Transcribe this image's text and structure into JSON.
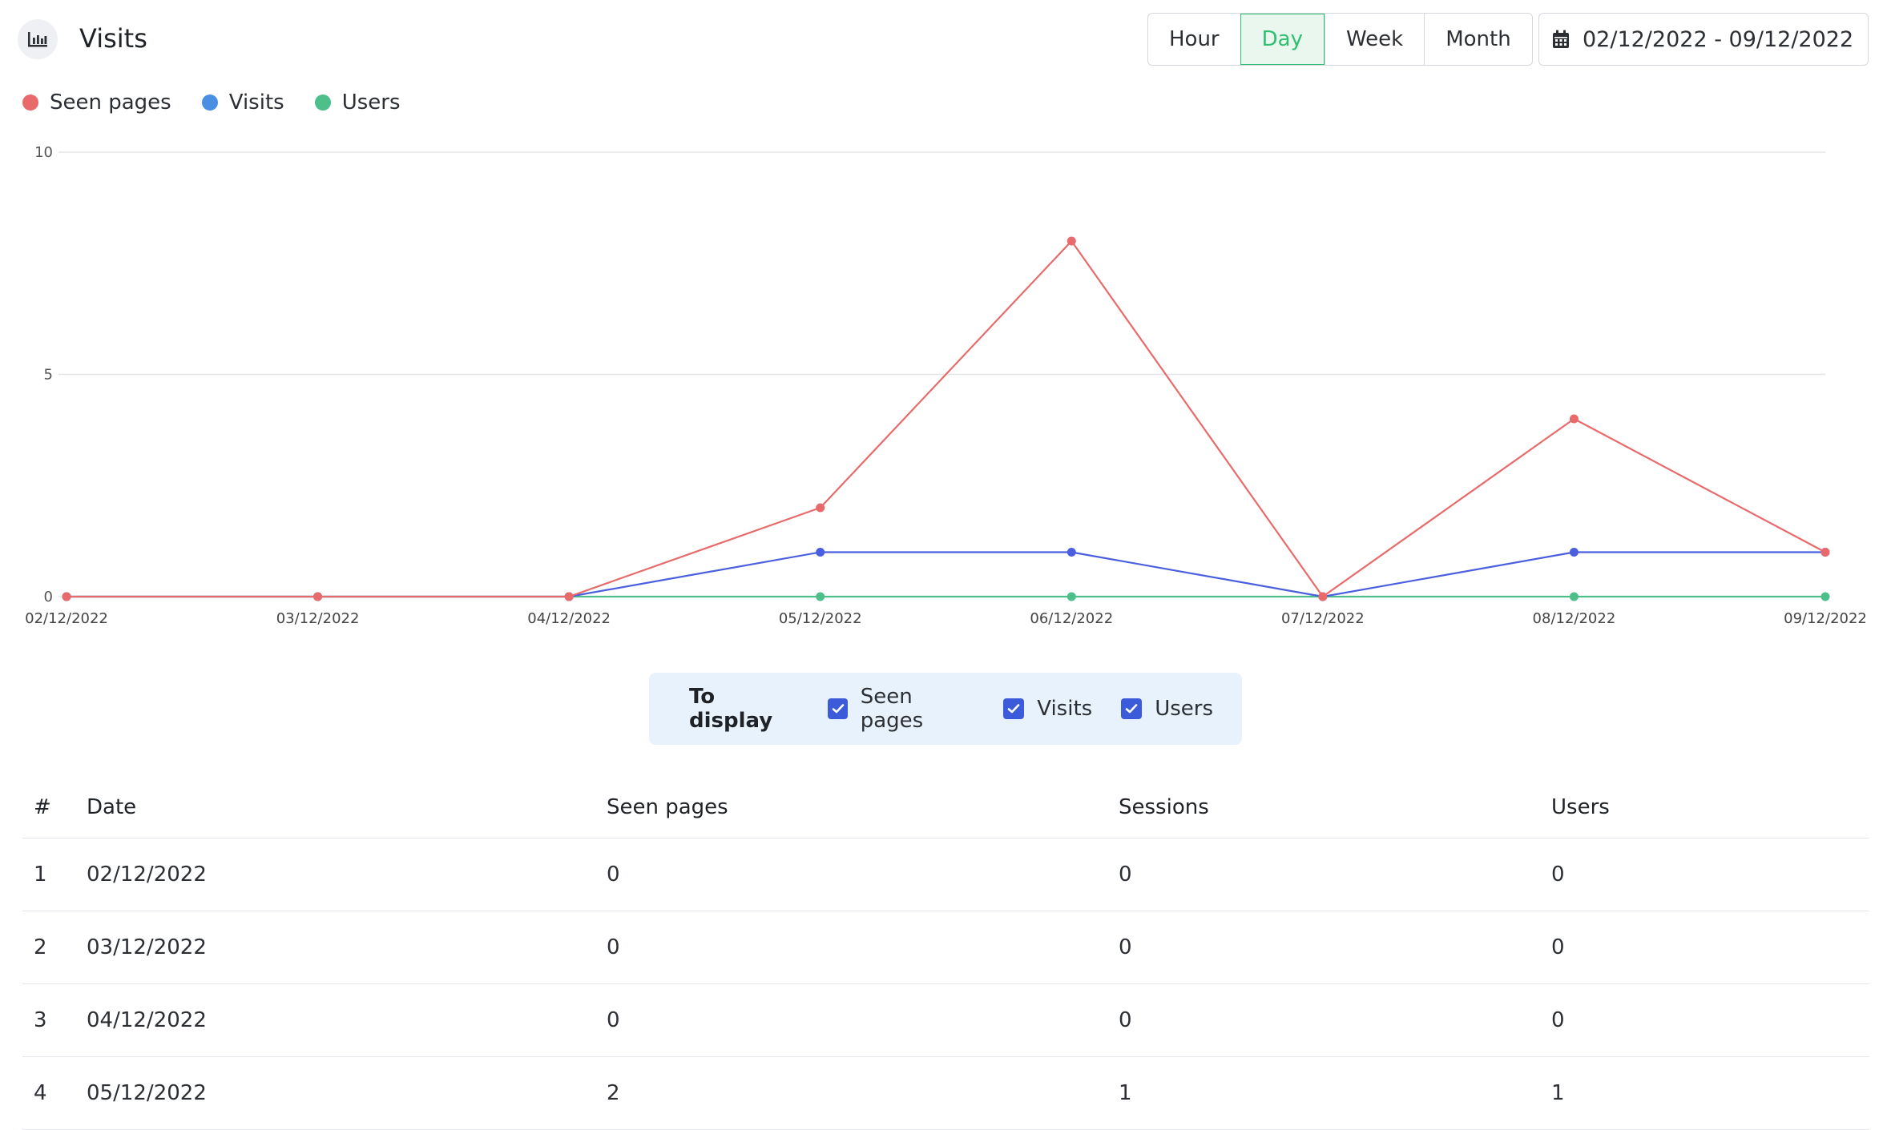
{
  "header": {
    "title": "Visits",
    "title_icon": "bar-chart-icon",
    "periods": [
      "Hour",
      "Day",
      "Week",
      "Month"
    ],
    "active_period": "Day",
    "date_range": "02/12/2022 - 09/12/2022",
    "date_icon": "calendar-icon"
  },
  "legend": [
    {
      "label": "Seen pages",
      "color": "#e86a6a"
    },
    {
      "label": "Visits",
      "color": "#4a90e2"
    },
    {
      "label": "Users",
      "color": "#4cbf8a"
    }
  ],
  "chart_data": {
    "type": "line",
    "categories": [
      "02/12/2022",
      "03/12/2022",
      "04/12/2022",
      "05/12/2022",
      "06/12/2022",
      "07/12/2022",
      "08/12/2022",
      "09/12/2022"
    ],
    "series": [
      {
        "name": "Seen pages",
        "color": "#e86a6a",
        "values": [
          0,
          0,
          0,
          2,
          8,
          0,
          4,
          1
        ]
      },
      {
        "name": "Visits",
        "color": "#4a5fe0",
        "values": [
          0,
          0,
          0,
          1,
          1,
          0,
          1,
          1
        ]
      },
      {
        "name": "Users",
        "color": "#4cbf8a",
        "values": [
          0,
          0,
          0,
          0,
          0,
          0,
          0,
          0
        ]
      }
    ],
    "yticks": [
      "0",
      "5",
      "10"
    ],
    "ylim": [
      0,
      10
    ],
    "grid": true,
    "legend_position": "top-left"
  },
  "display": {
    "label": "To display",
    "options": [
      {
        "label": "Seen pages",
        "checked": true
      },
      {
        "label": "Visits",
        "checked": true
      },
      {
        "label": "Users",
        "checked": true
      }
    ]
  },
  "table": {
    "headers": [
      "#",
      "Date",
      "Seen pages",
      "Sessions",
      "Users"
    ],
    "rows": [
      [
        "1",
        "02/12/2022",
        "0",
        "0",
        "0"
      ],
      [
        "2",
        "03/12/2022",
        "0",
        "0",
        "0"
      ],
      [
        "3",
        "04/12/2022",
        "0",
        "0",
        "0"
      ],
      [
        "4",
        "05/12/2022",
        "2",
        "1",
        "1"
      ]
    ]
  }
}
